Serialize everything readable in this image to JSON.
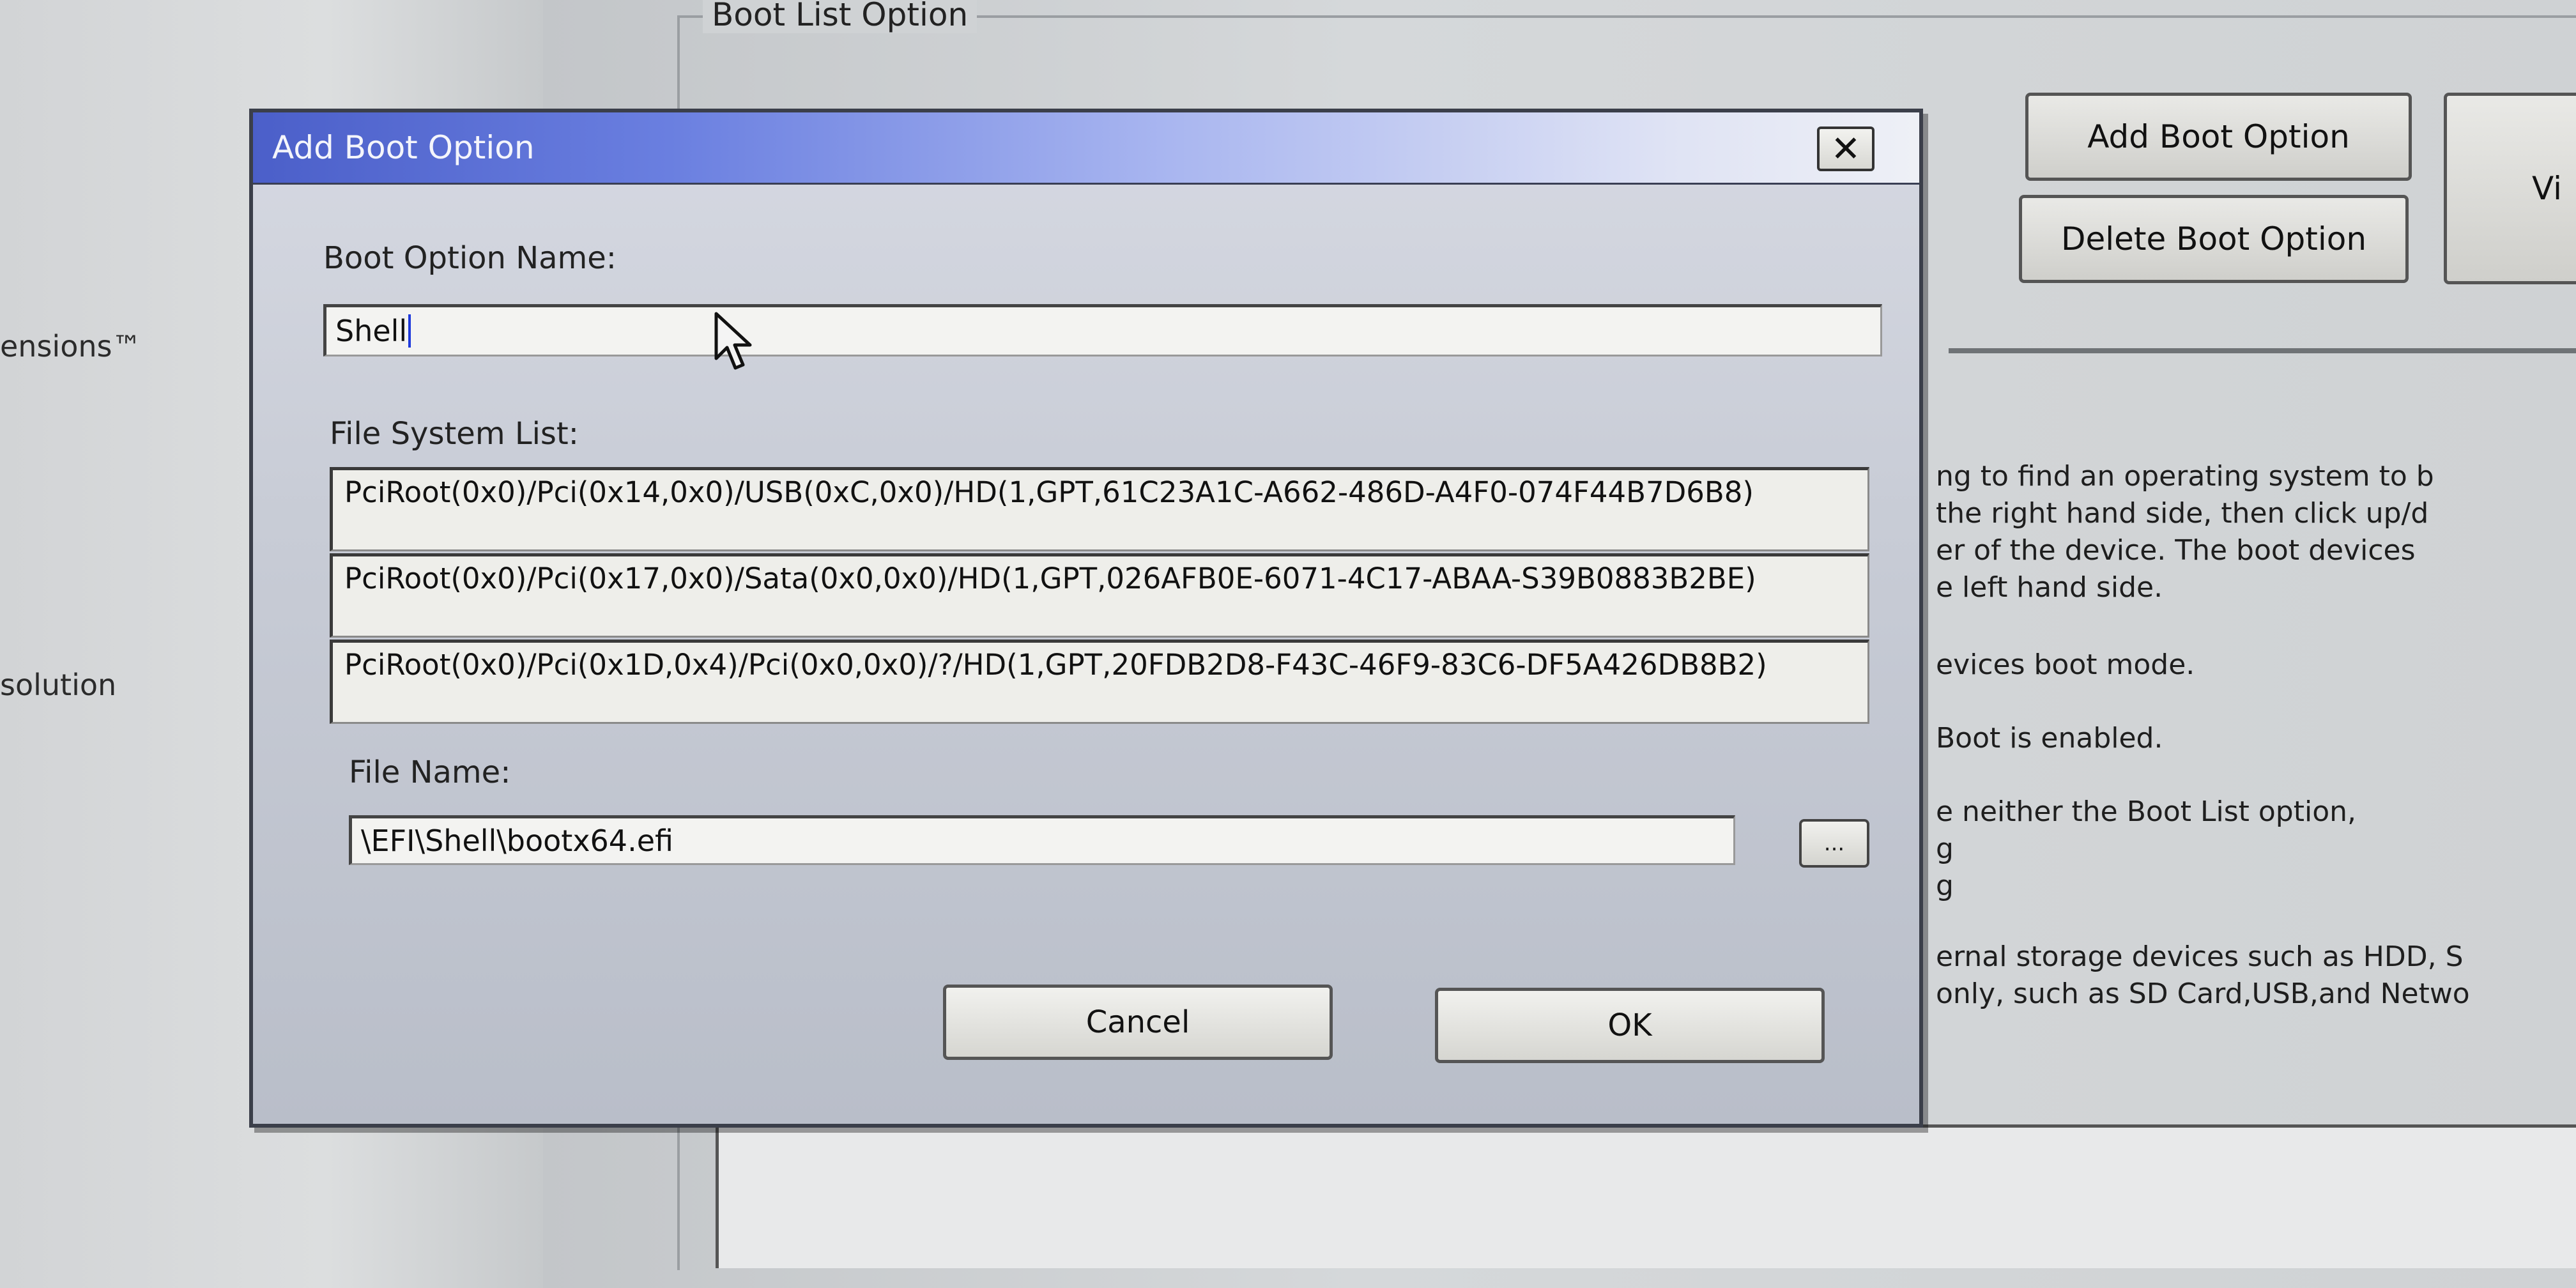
{
  "background": {
    "left_items": [
      "ensions™",
      "solution"
    ],
    "group_title": "Boot List Option",
    "add_button": "Add Boot Option",
    "delete_button": "Delete Boot Option",
    "view_button_partial": "Vi",
    "help_lines": [
      "ng to find an operating system to b",
      "the right hand side, then click up/d",
      "er of the device. The boot devices",
      "e left hand side.",
      "evices boot mode.",
      "Boot is enabled.",
      "e neither the Boot List option,",
      "g",
      "g",
      "ernal storage devices such as HDD, S",
      "only, such as SD Card,USB,and Netwo"
    ]
  },
  "dialog": {
    "title": "Add Boot Option",
    "close_label": "✕",
    "boot_option_name_label": "Boot Option Name:",
    "boot_option_name_value": "Shell",
    "file_system_list_label": "File System List:",
    "file_systems": [
      "PciRoot(0x0)/Pci(0x14,0x0)/USB(0xC,0x0)/HD(1,GPT,61C23A1C-A662-486D-A4F0-074F44B7D6B8)",
      "PciRoot(0x0)/Pci(0x17,0x0)/Sata(0x0,0x0)/HD(1,GPT,026AFB0E-6071-4C17-ABAA-S39B0883B2BE)",
      "PciRoot(0x0)/Pci(0x1D,0x4)/Pci(0x0,0x0)/?/HD(1,GPT,20FDB2D8-F43C-46F9-83C6-DF5A426DB8B2)"
    ],
    "file_name_label": "File Name:",
    "file_name_value": "\\EFI\\Shell\\bootx64.efi",
    "browse_label": "...",
    "cancel_label": "Cancel",
    "ok_label": "OK"
  }
}
